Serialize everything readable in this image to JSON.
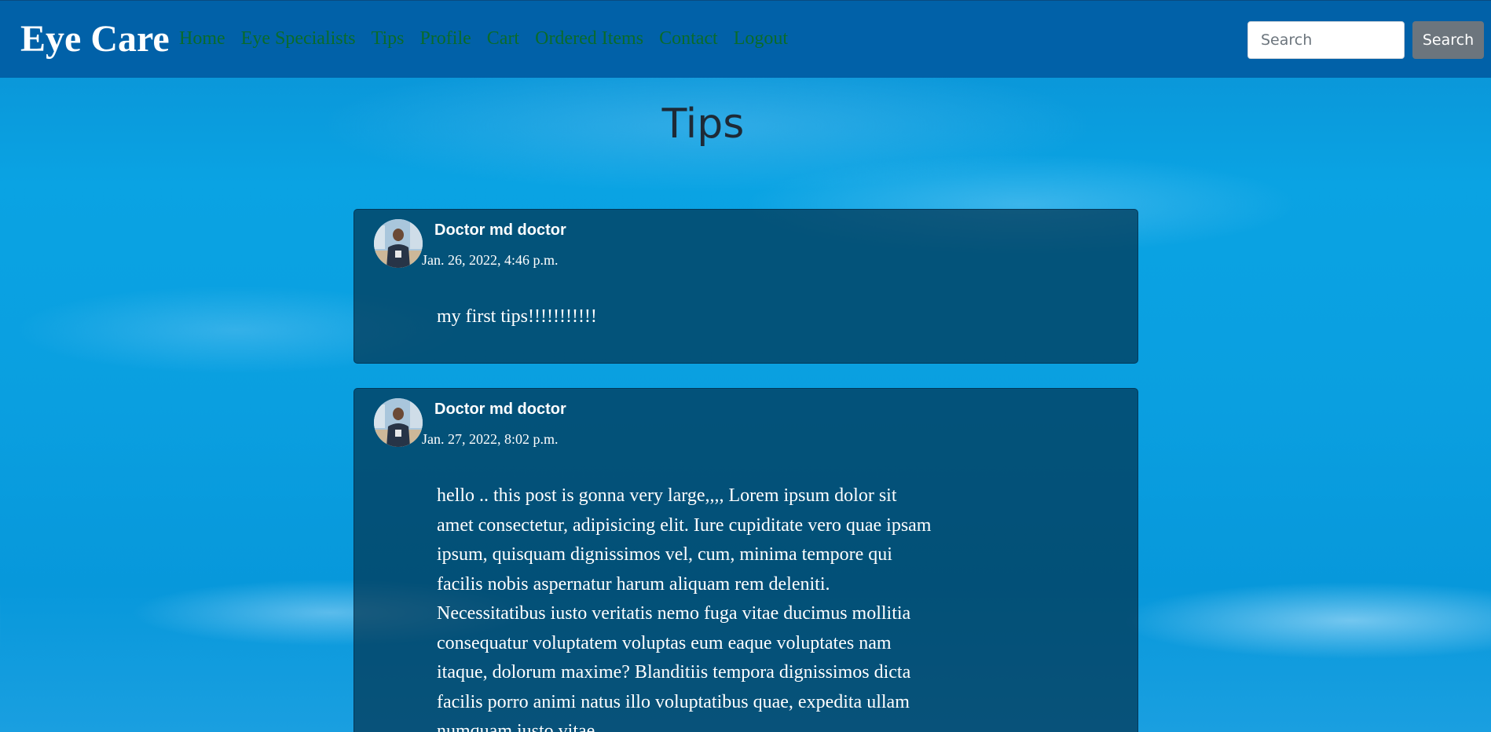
{
  "navbar": {
    "brand": "Eye Care",
    "links": [
      "Home",
      "Eye Specialists",
      "Tips",
      "Profile",
      "Cart",
      "Ordered Items",
      "Contact",
      "Logout"
    ],
    "search_placeholder": "Search",
    "search_button": "Search",
    "link_color": "#0a6b2a",
    "background": "#0161a8"
  },
  "page": {
    "title": "Tips"
  },
  "tips": [
    {
      "author": "Doctor md doctor",
      "date": "Jan. 26, 2022, 4:46 p.m.",
      "body": "my first tips!!!!!!!!!!!"
    },
    {
      "author": "Doctor md doctor",
      "date": "Jan. 27, 2022, 8:02 p.m.",
      "body": "hello .. this post is gonna very large,,,, Lorem ipsum dolor sit amet consectetur, adipisicing elit. Iure cupiditate vero quae ipsam ipsum, quisquam dignissimos vel, cum, minima tempore qui facilis nobis aspernatur harum aliquam rem deleniti. Necessitatibus iusto veritatis nemo fuga vitae ducimus mollitia consequatur voluptatem voluptas eum eaque voluptates nam itaque, dolorum maxime? Blanditiis tempora dignissimos dicta facilis porro animi natus illo voluptatibus quae, expedita ullam numquam iusto vitae"
    }
  ]
}
